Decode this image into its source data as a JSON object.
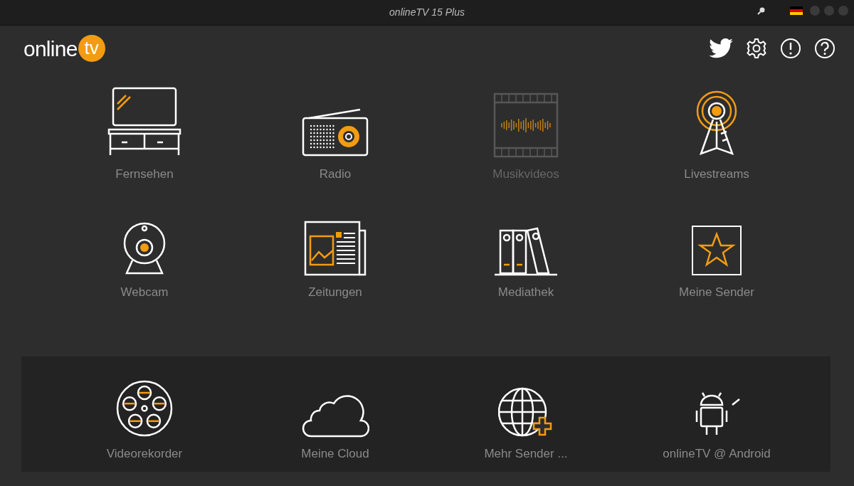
{
  "window": {
    "title": "onlineTV 15 Plus"
  },
  "logo": {
    "text": "online",
    "badge": "tv"
  },
  "tiles": [
    {
      "kind": "tv",
      "label": "Fernsehen",
      "disabled": false
    },
    {
      "kind": "radio",
      "label": "Radio",
      "disabled": false
    },
    {
      "kind": "film",
      "label": "Musikvideos",
      "disabled": true
    },
    {
      "kind": "tower",
      "label": "Livestreams",
      "disabled": false
    },
    {
      "kind": "webcam",
      "label": "Webcam",
      "disabled": false
    },
    {
      "kind": "newspaper",
      "label": "Zeitungen",
      "disabled": false
    },
    {
      "kind": "binders",
      "label": "Mediathek",
      "disabled": false
    },
    {
      "kind": "star",
      "label": "Meine Sender",
      "disabled": false
    }
  ],
  "bottom_tiles": [
    {
      "kind": "reel",
      "label": "Videorekorder",
      "disabled": false
    },
    {
      "kind": "cloud",
      "label": "Meine Cloud",
      "disabled": false
    },
    {
      "kind": "globe",
      "label": "Mehr Sender ...",
      "disabled": false
    },
    {
      "kind": "android",
      "label": "onlineTV @ Android",
      "disabled": false
    }
  ]
}
